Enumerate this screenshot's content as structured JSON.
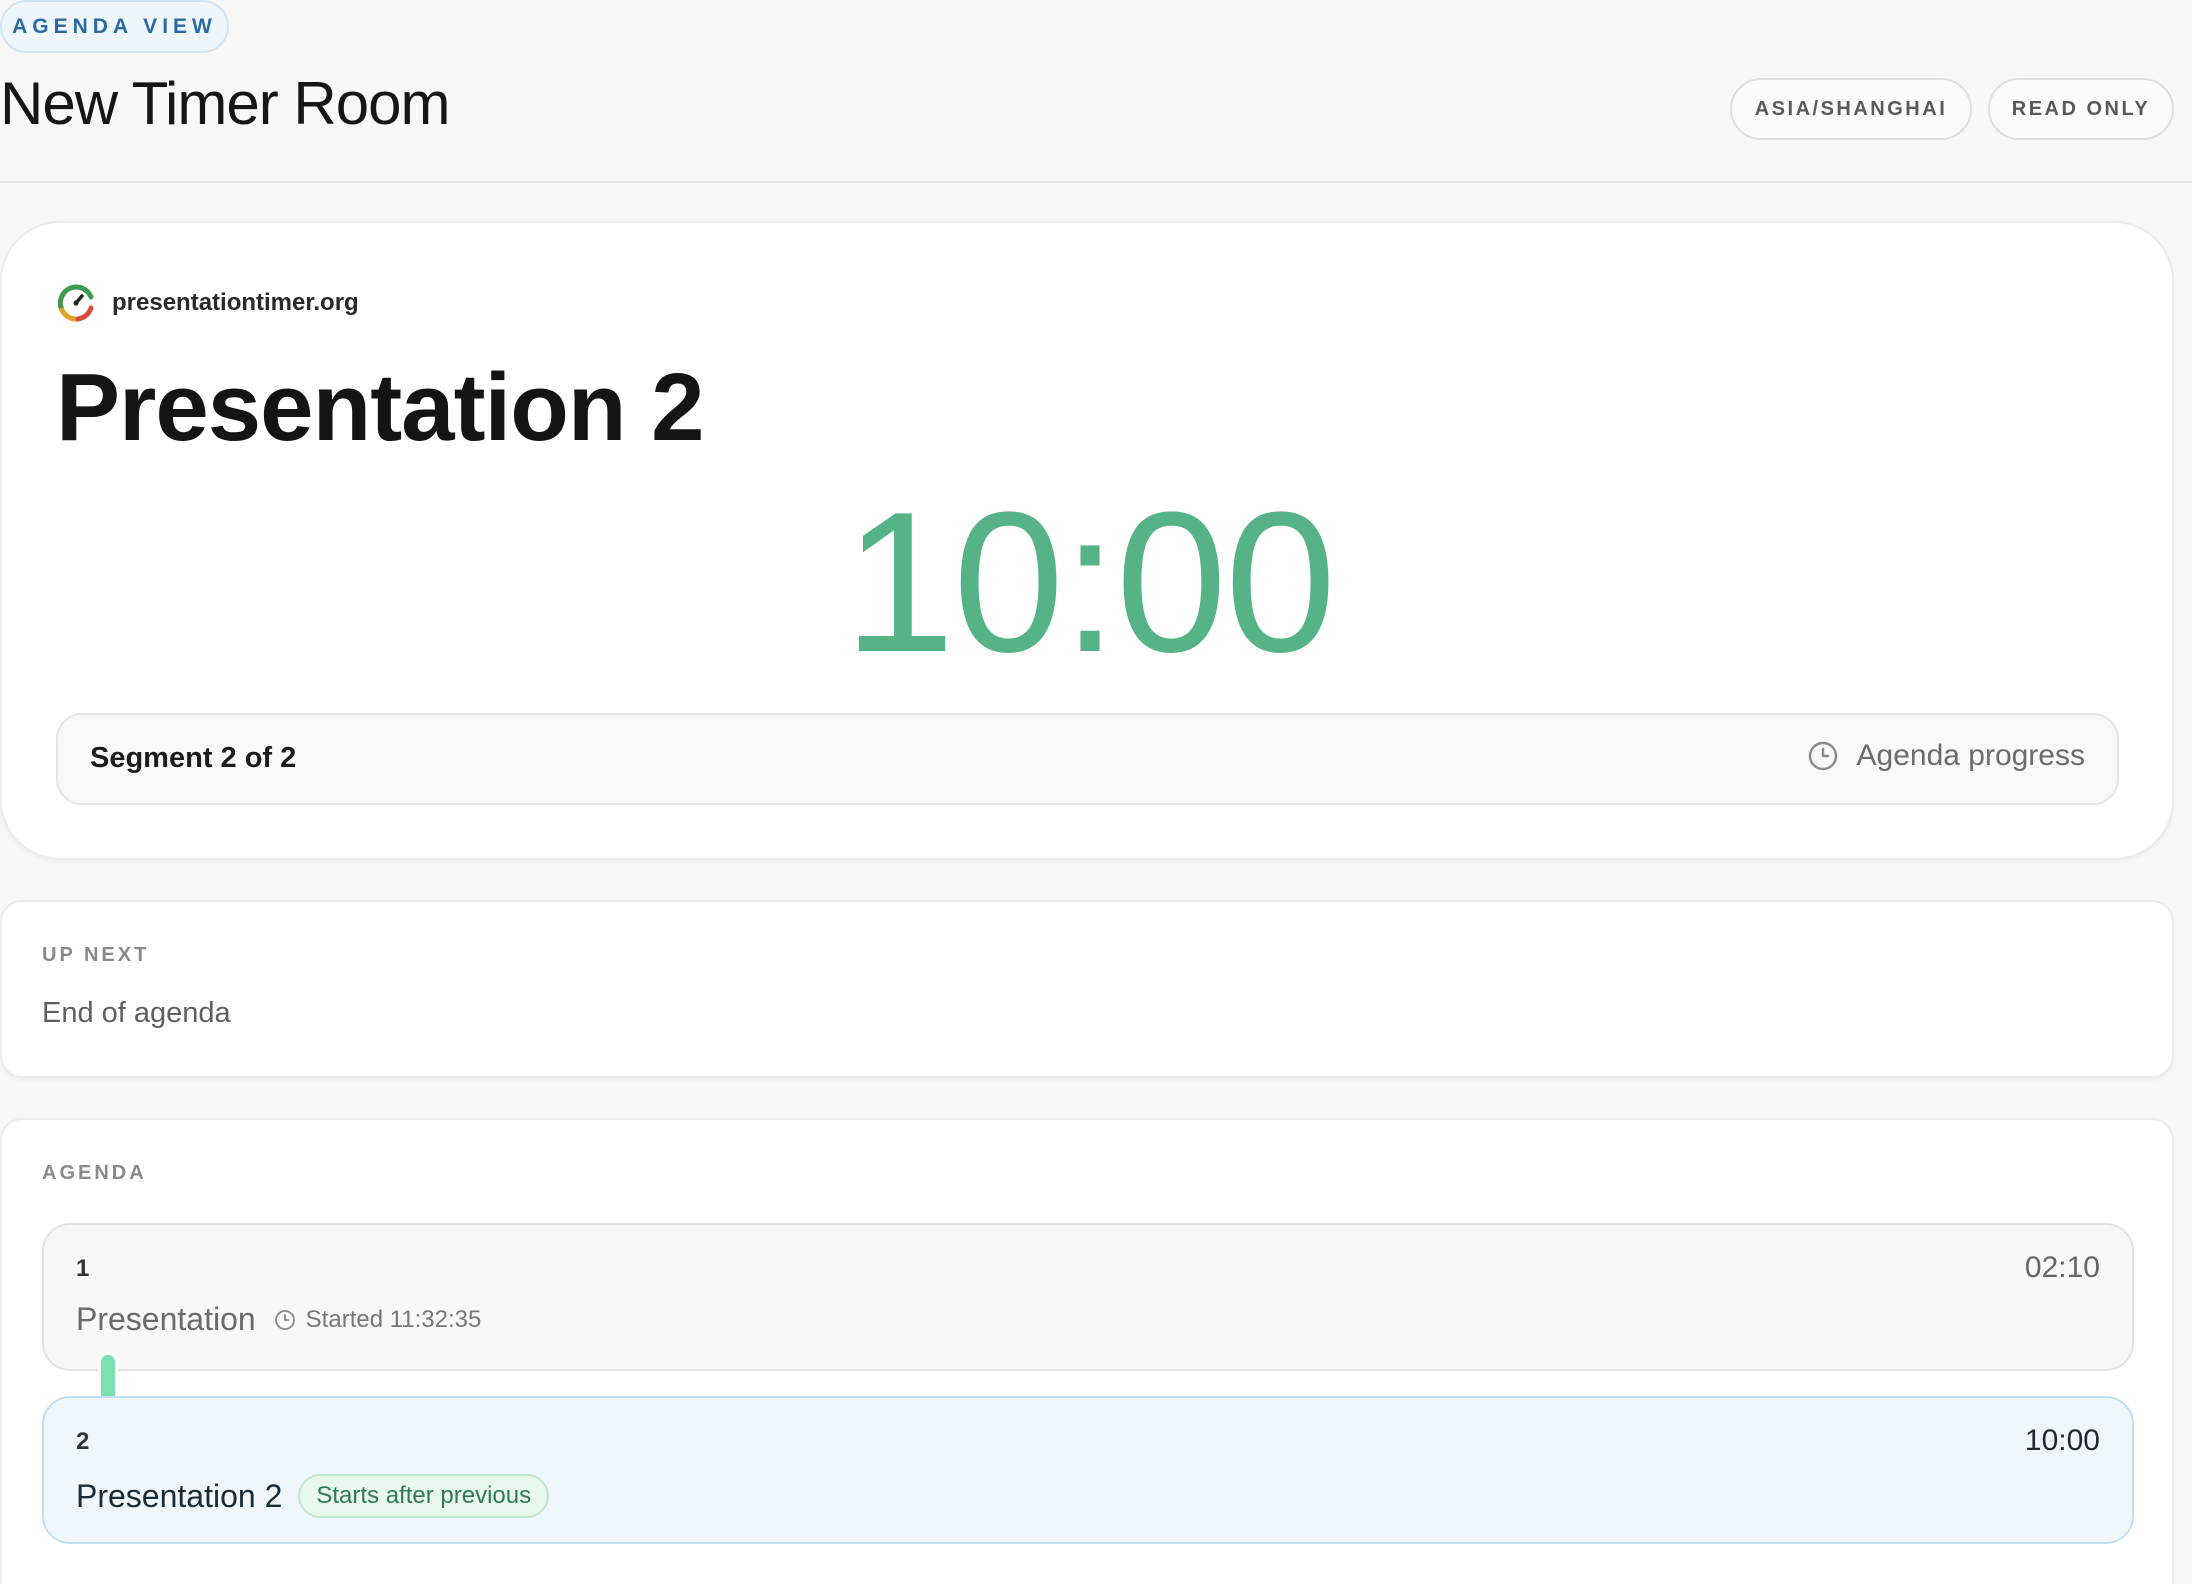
{
  "header": {
    "view_chip": "AGENDA VIEW",
    "room_title": "New Timer Room",
    "timezone": "ASIA/SHANGHAI",
    "access_mode": "READ ONLY"
  },
  "timer": {
    "brand": "presentationtimer.org",
    "current_title": "Presentation 2",
    "time_remaining": "10:00",
    "time_color": "#55b386",
    "segment_label": "Segment 2 of 2",
    "progress_link_label": "Agenda progress",
    "progress_icon": "clock-icon"
  },
  "up_next": {
    "label": "UP NEXT",
    "value": "End of agenda"
  },
  "agenda": {
    "label": "AGENDA",
    "items": [
      {
        "index": "1",
        "name": "Presentation",
        "duration": "02:10",
        "meta": "Started 11:32:35",
        "meta_icon": "clock-icon",
        "state": "completed"
      },
      {
        "index": "2",
        "name": "Presentation 2",
        "duration": "10:00",
        "tag": "Starts after previous",
        "state": "active"
      }
    ]
  }
}
